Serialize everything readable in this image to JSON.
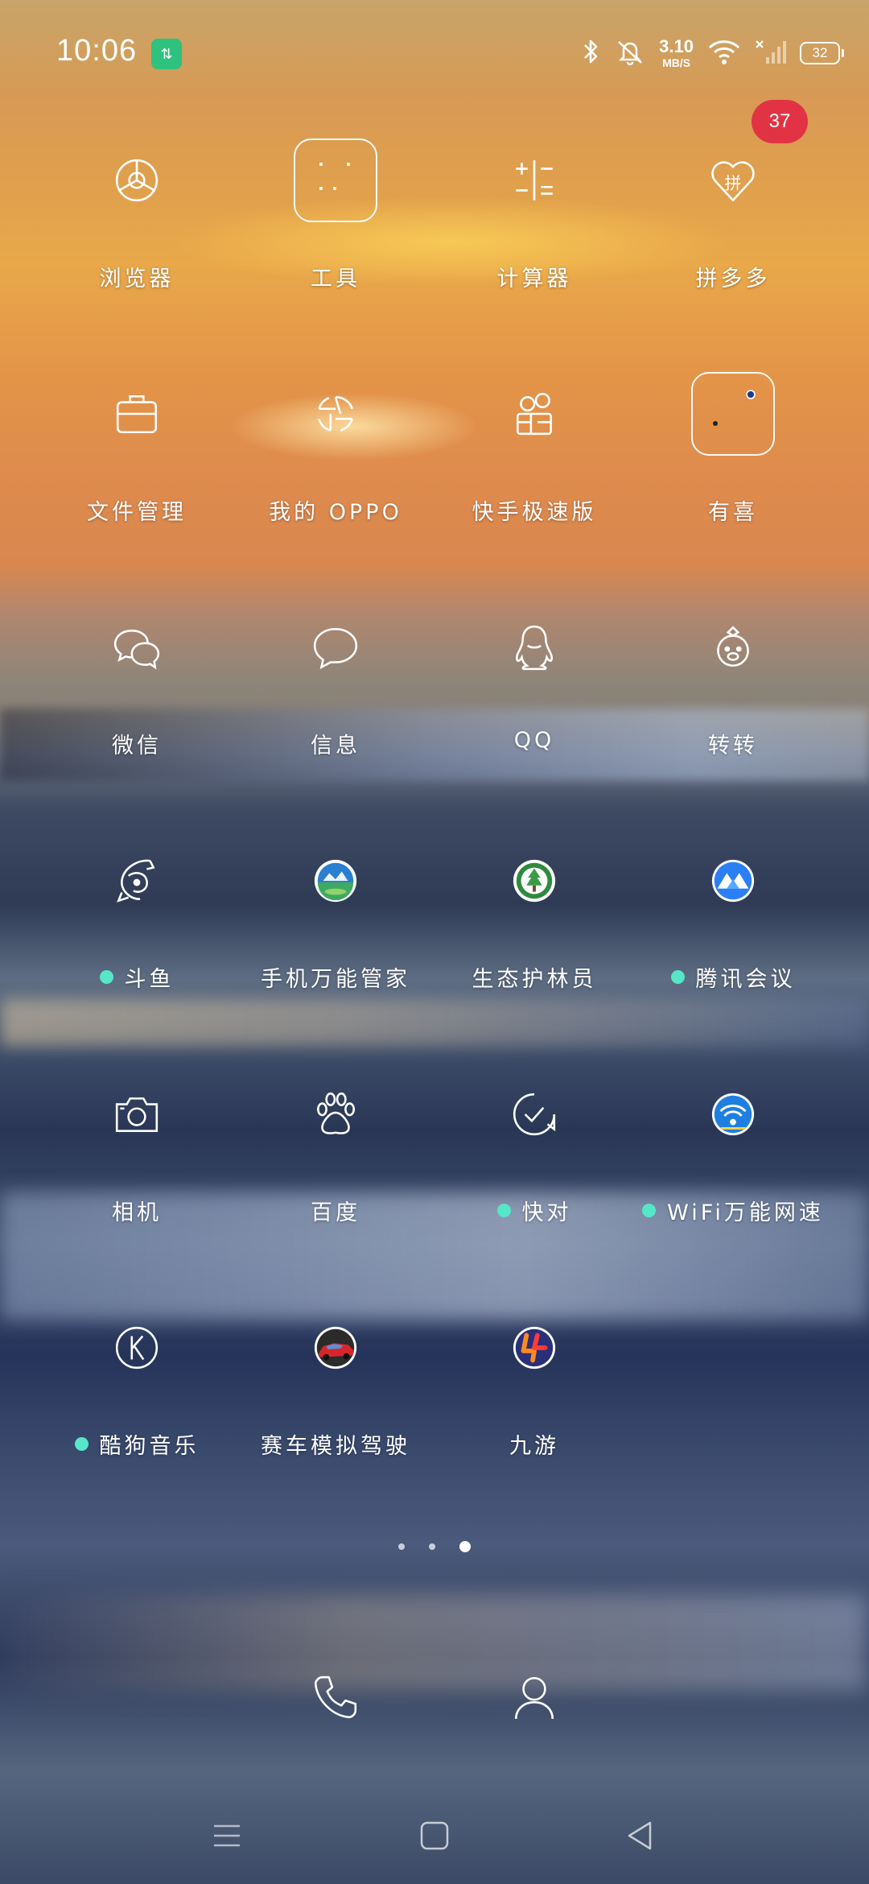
{
  "status_bar": {
    "time": "10:06",
    "badge_icon": "data-saver-icon",
    "network_speed_value": "3.10",
    "network_speed_unit": "MB/S",
    "battery": "32",
    "icons": [
      "bluetooth-icon",
      "silent-bell-icon",
      "wifi-icon",
      "signal-icon",
      "battery-icon"
    ]
  },
  "notification_badge": "37",
  "apps": [
    {
      "label": "浏览器",
      "icon": "browser-icon",
      "dot": false
    },
    {
      "label": "工具",
      "icon": "folder-icon",
      "dot": false
    },
    {
      "label": "计算器",
      "icon": "calculator-icon",
      "dot": false
    },
    {
      "label": "拼多多",
      "icon": "pinduoduo-icon",
      "dot": false
    },
    {
      "label": "文件管理",
      "icon": "briefcase-icon",
      "dot": false
    },
    {
      "label": "我的 OPPO",
      "icon": "oppo-aperture-icon",
      "dot": false
    },
    {
      "label": "快手极速版",
      "icon": "kuaishou-icon",
      "dot": false
    },
    {
      "label": "有喜",
      "icon": "folder-icon",
      "dot": false
    },
    {
      "label": "微信",
      "icon": "wechat-icon",
      "dot": false
    },
    {
      "label": "信息",
      "icon": "message-icon",
      "dot": false
    },
    {
      "label": "QQ",
      "icon": "qq-penguin-icon",
      "dot": false
    },
    {
      "label": "转转",
      "icon": "zhuanzhuan-icon",
      "dot": false
    },
    {
      "label": "斗鱼",
      "icon": "douyu-icon",
      "dot": true
    },
    {
      "label": "手机万能管家",
      "icon": "phone-manager-icon",
      "dot": false
    },
    {
      "label": "生态护林员",
      "icon": "forest-ranger-icon",
      "dot": false
    },
    {
      "label": "腾讯会议",
      "icon": "tencent-meeting-icon",
      "dot": true
    },
    {
      "label": "相机",
      "icon": "camera-icon",
      "dot": false
    },
    {
      "label": "百度",
      "icon": "baidu-paw-icon",
      "dot": false
    },
    {
      "label": "快对",
      "icon": "kuaidui-check-icon",
      "dot": true
    },
    {
      "label": "WiFi万能网速",
      "icon": "wifi-speed-icon",
      "dot": true
    },
    {
      "label": "酷狗音乐",
      "icon": "kugou-icon",
      "dot": true
    },
    {
      "label": "赛车模拟驾驶",
      "icon": "racing-car-icon",
      "dot": false
    },
    {
      "label": "九游",
      "icon": "jiuyou-icon",
      "dot": false
    }
  ],
  "dock": [
    {
      "name": "phone",
      "icon": "phone-icon"
    },
    {
      "name": "contacts",
      "icon": "contacts-icon"
    }
  ],
  "pager": {
    "count": 3,
    "active": 2
  },
  "nav": [
    "menu-icon",
    "home-icon",
    "back-icon"
  ],
  "colors": {
    "notification": "#e23344",
    "new_dot": "#56e6c8",
    "badge_green": "#2ec27e"
  }
}
